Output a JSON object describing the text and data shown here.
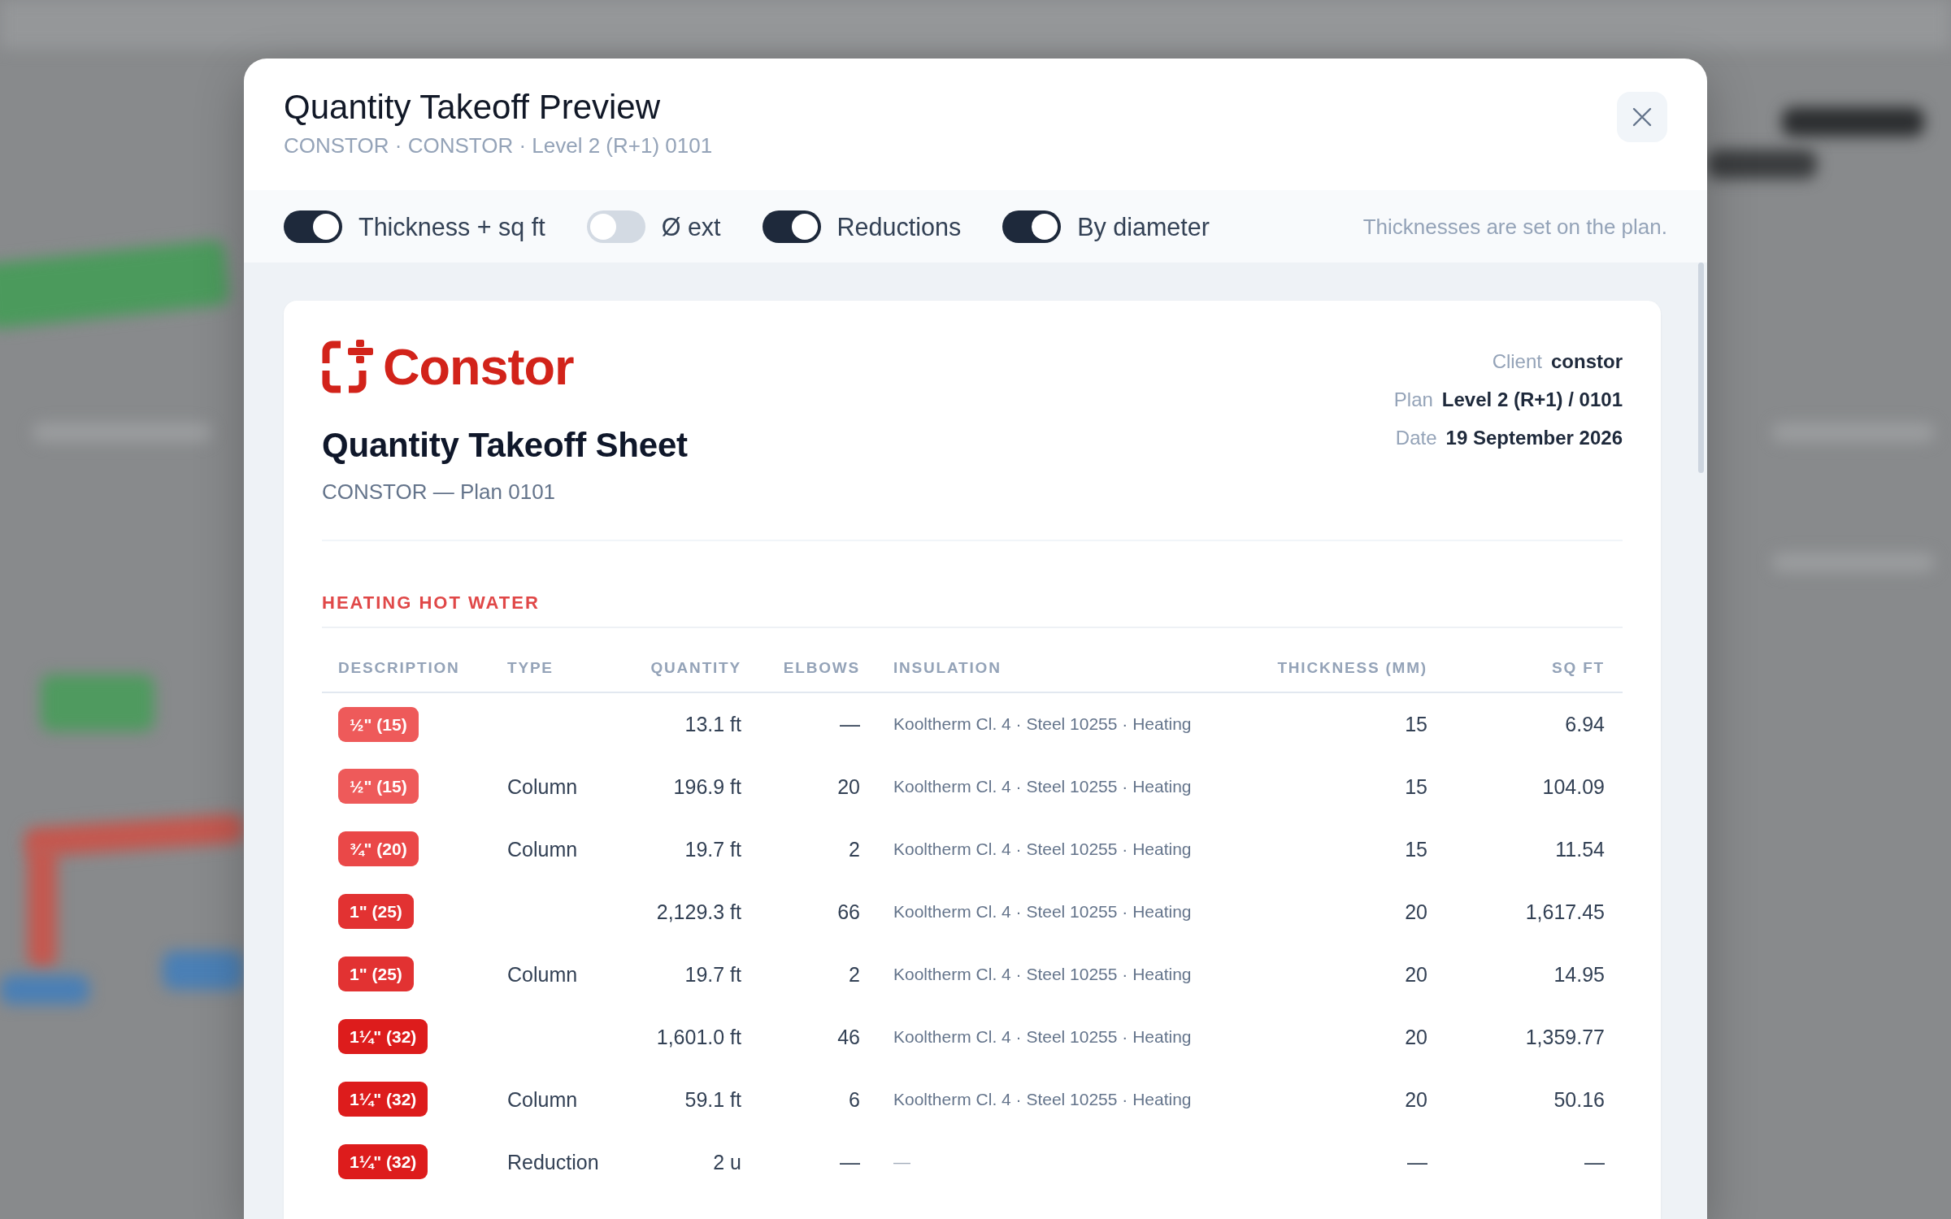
{
  "dialog": {
    "title": "Quantity Takeoff Preview",
    "subtitle": "CONSTOR · CONSTOR · Level 2 (R+1) 0101"
  },
  "options": {
    "toggles": [
      {
        "label": "Thickness + sq ft",
        "on": true
      },
      {
        "label": "Ø ext",
        "on": false
      },
      {
        "label": "Reductions",
        "on": true
      },
      {
        "label": "By diameter",
        "on": true
      }
    ],
    "hint": "Thicknesses are set on the plan."
  },
  "sheet": {
    "logo_text": "Constor",
    "title": "Quantity Takeoff Sheet",
    "subtitle": "CONSTOR — Plan 0101",
    "meta": [
      {
        "label": "Client",
        "value": "constor"
      },
      {
        "label": "Plan",
        "value": "Level 2 (R+1) / 0101"
      },
      {
        "label": "Date",
        "value": "19 September 2026"
      }
    ],
    "sections": [
      {
        "title": "HEATING HOT WATER",
        "columns": [
          "DESCRIPTION",
          "TYPE",
          "QUANTITY",
          "ELBOWS",
          "INSULATION",
          "THICKNESS (MM)",
          "SQ FT"
        ],
        "rows": [
          {
            "kind": "pipe",
            "size": "½\" (15)",
            "color": "#ee5a5a",
            "quantity": "13.1 ft",
            "elbows": "—",
            "insulation": "Kooltherm Cl. 4 · Steel 10255 · Heating",
            "thickness": "15",
            "sq_ft": "6.94"
          },
          {
            "kind": "pipe",
            "size": "½\" (15)",
            "color": "#ee5a5a",
            "type": "Column",
            "quantity": "196.9 ft",
            "elbows": "20",
            "insulation": "Kooltherm Cl. 4 · Steel 10255 · Heating",
            "thickness": "15",
            "sq_ft": "104.09"
          },
          {
            "kind": "pipe",
            "size": "¾\" (20)",
            "color": "#ea4848",
            "type": "Column",
            "quantity": "19.7 ft",
            "elbows": "2",
            "insulation": "Kooltherm Cl. 4 · Steel 10255 · Heating",
            "thickness": "15",
            "sq_ft": "11.54"
          },
          {
            "kind": "pipe",
            "size": "1\" (25)",
            "color": "#e23232",
            "quantity": "2,129.3 ft",
            "elbows": "66",
            "insulation": "Kooltherm Cl. 4 · Steel 10255 · Heating",
            "thickness": "20",
            "sq_ft": "1,617.45"
          },
          {
            "kind": "pipe",
            "size": "1\" (25)",
            "color": "#e23232",
            "type": "Column",
            "quantity": "19.7 ft",
            "elbows": "2",
            "insulation": "Kooltherm Cl. 4 · Steel 10255 · Heating",
            "thickness": "20",
            "sq_ft": "14.95"
          },
          {
            "kind": "pipe",
            "size": "1¼\" (32)",
            "color": "#dd1c1c",
            "quantity": "1,601.0 ft",
            "elbows": "46",
            "insulation": "Kooltherm Cl. 4 · Steel 10255 · Heating",
            "thickness": "20",
            "sq_ft": "1,359.77"
          },
          {
            "kind": "pipe",
            "size": "1¼\" (32)",
            "color": "#dd1c1c",
            "type": "Column",
            "quantity": "59.1 ft",
            "elbows": "6",
            "insulation": "Kooltherm Cl. 4 · Steel 10255 · Heating",
            "thickness": "20",
            "sq_ft": "50.16"
          },
          {
            "kind": "reduction",
            "size": "1¼\" (32)",
            "color": "#dd1c1c",
            "type": "Reduction",
            "quantity": "2 u",
            "elbows": "—",
            "insulation": "—",
            "thickness": "—",
            "sq_ft": "—"
          }
        ]
      }
    ]
  }
}
